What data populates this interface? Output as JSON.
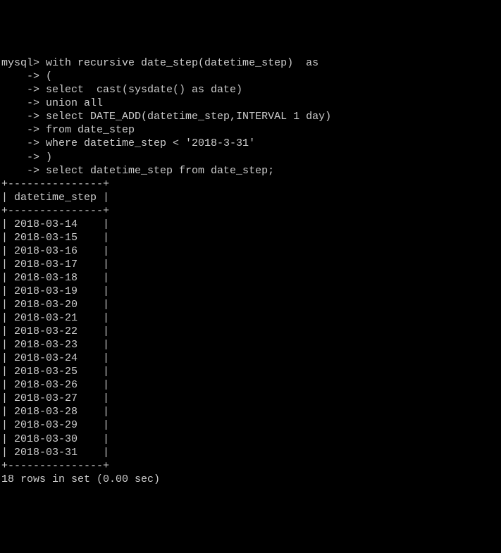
{
  "terminal": {
    "prompt": "mysql> ",
    "continuation": "    -> ",
    "sql_lines": [
      "with recursive date_step(datetime_step)  as",
      "(",
      "select  cast(sysdate() as date)",
      "union all",
      "select DATE_ADD(datetime_step,INTERVAL 1 day)",
      "from date_step",
      "where datetime_step < '2018-3-31'",
      ")",
      "select datetime_step from date_step;"
    ],
    "table_border": "+---------------+",
    "column_header": "| datetime_step |",
    "rows": [
      "| 2018-03-14    |",
      "| 2018-03-15    |",
      "| 2018-03-16    |",
      "| 2018-03-17    |",
      "| 2018-03-18    |",
      "| 2018-03-19    |",
      "| 2018-03-20    |",
      "| 2018-03-21    |",
      "| 2018-03-22    |",
      "| 2018-03-23    |",
      "| 2018-03-24    |",
      "| 2018-03-25    |",
      "| 2018-03-26    |",
      "| 2018-03-27    |",
      "| 2018-03-28    |",
      "| 2018-03-29    |",
      "| 2018-03-30    |",
      "| 2018-03-31    |"
    ],
    "summary": "18 rows in set (0.00 sec)"
  }
}
